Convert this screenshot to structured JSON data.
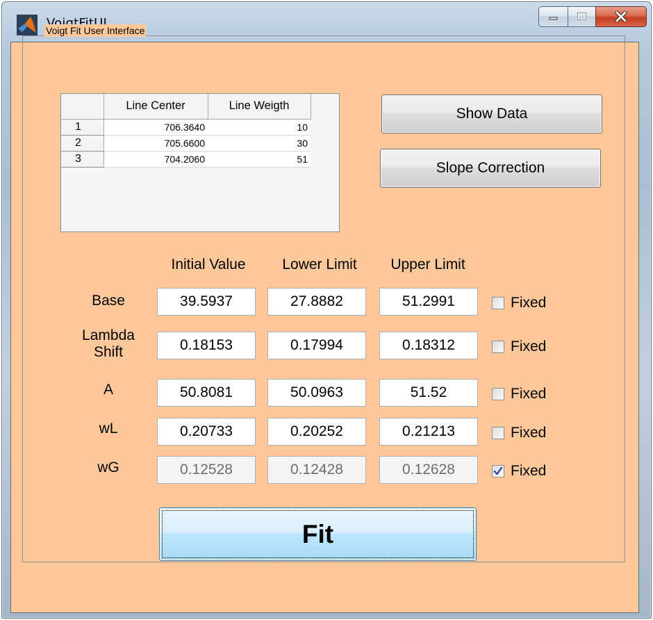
{
  "window": {
    "title": "VoigtFitUI"
  },
  "panel": {
    "title": "Voigt Fit User Interface"
  },
  "table": {
    "columns": [
      "Line Center",
      "Line Weigth"
    ],
    "rows": [
      {
        "index": "1",
        "center": "706.3640",
        "weight": "10"
      },
      {
        "index": "2",
        "center": "705.6600",
        "weight": "30"
      },
      {
        "index": "3",
        "center": "704.2060",
        "weight": "51"
      }
    ]
  },
  "buttons": {
    "show_data": "Show Data",
    "slope_correction": "Slope Correction",
    "fit": "Fit"
  },
  "params": {
    "headers": {
      "initial": "Initial Value",
      "lower": "Lower Limit",
      "upper": "Upper Limit"
    },
    "fixed_label": "Fixed",
    "rows": [
      {
        "label": "Base",
        "initial": "39.5937",
        "lower": "27.8882",
        "upper": "51.2991",
        "fixed": false
      },
      {
        "label_line1": "Lambda",
        "label_line2": "Shift",
        "initial": "0.18153",
        "lower": "0.17994",
        "upper": "0.18312",
        "fixed": false
      },
      {
        "label": "A",
        "initial": "50.8081",
        "lower": "50.0963",
        "upper": "51.52",
        "fixed": false
      },
      {
        "label": "wL",
        "initial": "0.20733",
        "lower": "0.20252",
        "upper": "0.21213",
        "fixed": false
      },
      {
        "label": "wG",
        "initial": "0.12528",
        "lower": "0.12428",
        "upper": "0.12628",
        "fixed": true
      }
    ]
  },
  "colors": {
    "panel_background": "#ffc89a",
    "fit_button": "#bee6fd",
    "close_button": "#c1401f"
  }
}
